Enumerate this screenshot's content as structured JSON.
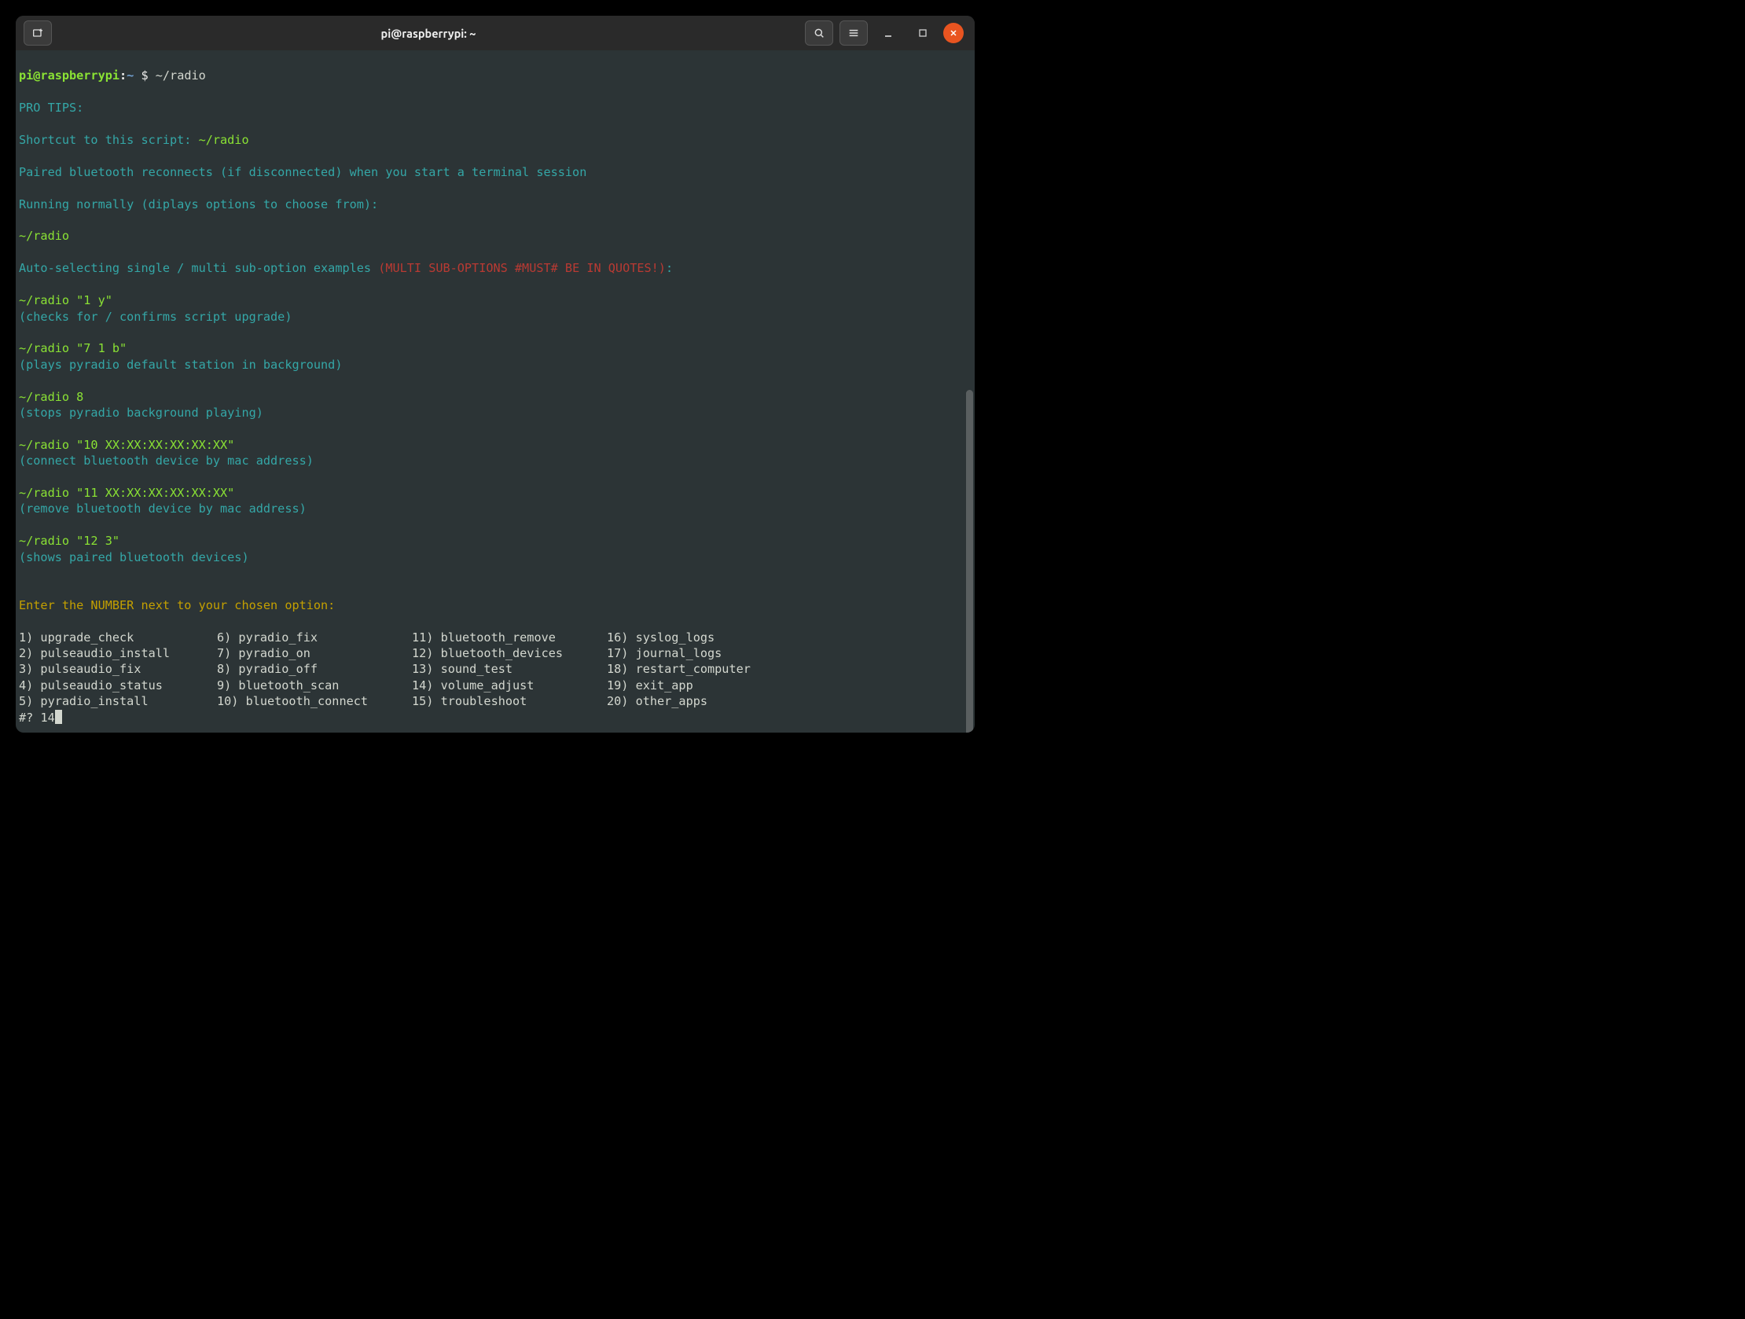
{
  "titlebar": {
    "title": "pi@raspberrypi: ~"
  },
  "prompt": {
    "user_host": "pi@raspberrypi",
    "sep": ":",
    "path": "~",
    "dollar": " $ ",
    "command": "~/radio"
  },
  "tips": {
    "header": "PRO TIPS:",
    "shortcut_label": "Shortcut to this script: ",
    "shortcut_cmd": "~/radio",
    "bt_reconnect": "Paired bluetooth reconnects (if disconnected) when you start a terminal session",
    "running_normally": "Running normally (diplays options to choose from):",
    "cmd_plain": "~/radio",
    "auto_label": "Auto-selecting single / multi sub-option examples ",
    "auto_warn": "(MULTI SUB-OPTIONS #MUST# BE IN QUOTES!)",
    "auto_colon": ":",
    "ex1_cmd": "~/radio \"1 y\"",
    "ex1_note": "(checks for / confirms script upgrade)",
    "ex2_cmd": "~/radio \"7 1 b\"",
    "ex2_note": "(plays pyradio default station in background)",
    "ex3_cmd": "~/radio 8",
    "ex3_note": "(stops pyradio background playing)",
    "ex4_cmd": "~/radio \"10 XX:XX:XX:XX:XX:XX\"",
    "ex4_note": "(connect bluetooth device by mac address)",
    "ex5_cmd": "~/radio \"11 XX:XX:XX:XX:XX:XX\"",
    "ex5_note": "(remove bluetooth device by mac address)",
    "ex6_cmd": "~/radio \"12 3\"",
    "ex6_note": "(shows paired bluetooth devices)"
  },
  "menu": {
    "instruction": "Enter the NUMBER next to your chosen option:",
    "options": {
      "c1r1": "1) upgrade_check",
      "c1r2": "2) pulseaudio_install",
      "c1r3": "3) pulseaudio_fix",
      "c1r4": "4) pulseaudio_status",
      "c1r5": "5) pyradio_install",
      "c2r1": " 6) pyradio_fix",
      "c2r2": " 7) pyradio_on",
      "c2r3": " 8) pyradio_off",
      "c2r4": " 9) bluetooth_scan",
      "c2r5": "10) bluetooth_connect",
      "c3r1": "11) bluetooth_remove",
      "c3r2": "12) bluetooth_devices",
      "c3r3": "13) sound_test",
      "c3r4": "14) volume_adjust",
      "c3r5": "15) troubleshoot",
      "c4r1": "16) syslog_logs",
      "c4r2": "17) journal_logs",
      "c4r3": "18) restart_computer",
      "c4r4": "19) exit_app",
      "c4r5": "20) other_apps"
    },
    "prompt_prefix": "#? ",
    "prompt_input": "14"
  }
}
